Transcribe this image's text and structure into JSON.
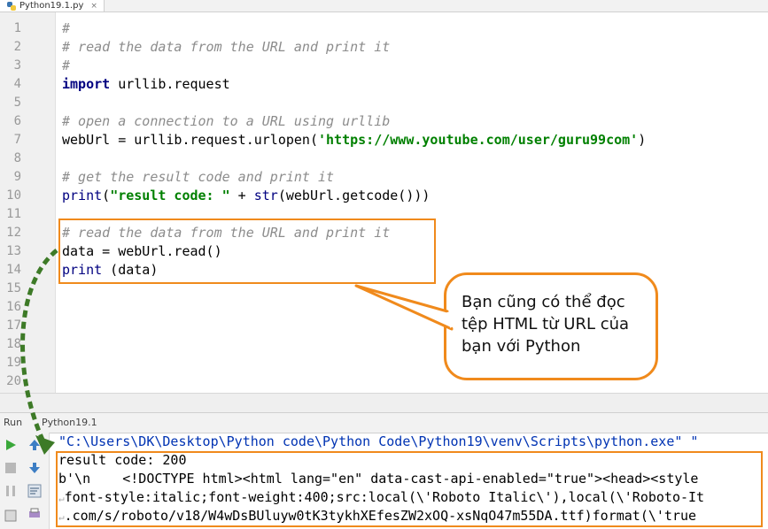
{
  "tab": {
    "filename": "Python19.1.py",
    "close": "×"
  },
  "editor": {
    "lines": [
      {
        "num": "1",
        "segments": [
          {
            "t": "#",
            "c": "cm"
          }
        ]
      },
      {
        "num": "2",
        "segments": [
          {
            "t": "# read the data from the URL and print it",
            "c": "cm"
          }
        ]
      },
      {
        "num": "3",
        "segments": [
          {
            "t": "#",
            "c": "cm"
          }
        ]
      },
      {
        "num": "4",
        "segments": [
          {
            "t": "import",
            "c": "kw"
          },
          {
            "t": " urllib.request",
            "c": ""
          }
        ]
      },
      {
        "num": "5",
        "segments": []
      },
      {
        "num": "6",
        "segments": [
          {
            "t": "# open a connection to a URL using urllib",
            "c": "cm"
          }
        ]
      },
      {
        "num": "7",
        "segments": [
          {
            "t": "webUrl = urllib.request.urlopen(",
            "c": ""
          },
          {
            "t": "'https://www.youtube.com/user/guru99com'",
            "c": "str"
          },
          {
            "t": ")",
            "c": ""
          }
        ]
      },
      {
        "num": "8",
        "segments": []
      },
      {
        "num": "9",
        "segments": [
          {
            "t": "# get the result code and print it",
            "c": "cm"
          }
        ]
      },
      {
        "num": "10",
        "segments": [
          {
            "t": "print",
            "c": "bi"
          },
          {
            "t": "(",
            "c": ""
          },
          {
            "t": "\"result code: \"",
            "c": "str"
          },
          {
            "t": " + ",
            "c": ""
          },
          {
            "t": "str",
            "c": "bi"
          },
          {
            "t": "(webUrl.getcode()))",
            "c": ""
          }
        ]
      },
      {
        "num": "11",
        "segments": []
      },
      {
        "num": "12",
        "segments": [
          {
            "t": "# read the data from the URL and print it",
            "c": "cm"
          }
        ]
      },
      {
        "num": "13",
        "segments": [
          {
            "t": "data = webUrl.read()",
            "c": ""
          }
        ]
      },
      {
        "num": "14",
        "segments": [
          {
            "t": "print",
            "c": "bi"
          },
          {
            "t": " (data)",
            "c": ""
          }
        ]
      },
      {
        "num": "15",
        "segments": []
      },
      {
        "num": "16",
        "segments": []
      },
      {
        "num": "17",
        "segments": []
      },
      {
        "num": "18",
        "segments": []
      },
      {
        "num": "19",
        "segments": []
      },
      {
        "num": "20",
        "segments": []
      }
    ]
  },
  "callout": {
    "lines": [
      "Bạn cũng có thể đọc",
      "tệp HTML từ URL của",
      "bạn với Python"
    ]
  },
  "run": {
    "label": "Run",
    "file": "Python19.1",
    "console": [
      {
        "text": "\"C:\\Users\\DK\\Desktop\\Python code\\Python Code\\Python19\\venv\\Scripts\\python.exe\" \"",
        "c": "path",
        "wrap": false
      },
      {
        "text": "result code: 200",
        "c": "",
        "wrap": false
      },
      {
        "text": "b'\\n    <!DOCTYPE html><html lang=\"en\" data-cast-api-enabled=\"true\"><head><style",
        "c": "",
        "wrap": false
      },
      {
        "text": "font-style:italic;font-weight:400;src:local(\\'Roboto Italic\\'),local(\\'Roboto-It",
        "c": "",
        "wrap": true
      },
      {
        "text": ".com/s/roboto/v18/W4wDsBUluyw0tK3tykhXEfesZW2xOQ-xsNqO47m55DA.ttf)format(\\'true",
        "c": "",
        "wrap": true
      }
    ]
  },
  "colors": {
    "highlight": "#f08a1c",
    "arrow": "#3d7a27"
  }
}
